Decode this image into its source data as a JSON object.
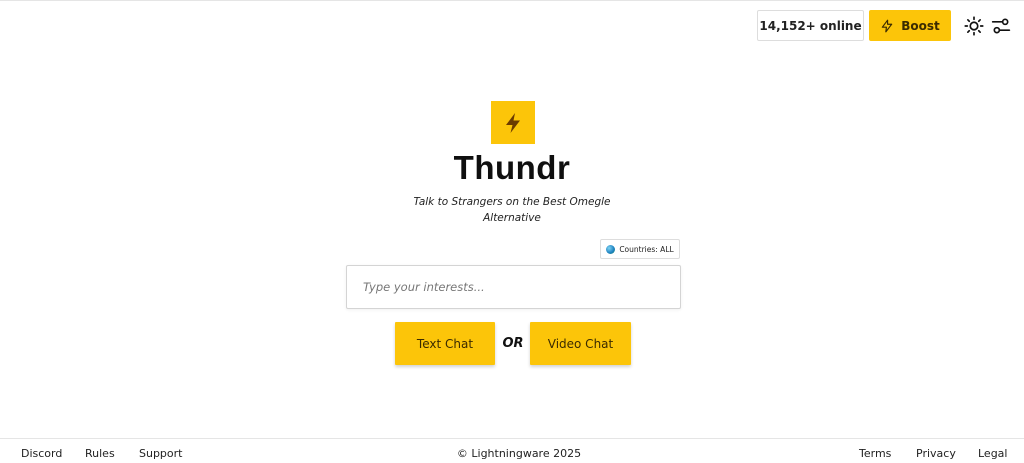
{
  "header": {
    "online_count": "14,152+ online",
    "boost_label": "Boost",
    "boost_icon": "lightning-bolt-icon",
    "theme_icon": "sun-icon",
    "settings_icon": "sliders-icon"
  },
  "hero": {
    "logo_icon": "lightning-bolt-icon",
    "title": "Thundr",
    "tagline": "Talk to Strangers on the Best Omegle Alternative",
    "countries_label": "Countries: ALL",
    "interests_placeholder": "Type your interests...",
    "text_chat_label": "Text Chat",
    "or_label": "OR",
    "video_chat_label": "Video Chat"
  },
  "footer": {
    "links_left": [
      "Discord",
      "Rules",
      "Support"
    ],
    "copyright": "© Lightningware 2025",
    "links_right": [
      "Terms",
      "Privacy",
      "Legal"
    ]
  },
  "colors": {
    "accent": "#fcc509",
    "accent_text": "#3b2b00",
    "border": "#dddddd"
  }
}
